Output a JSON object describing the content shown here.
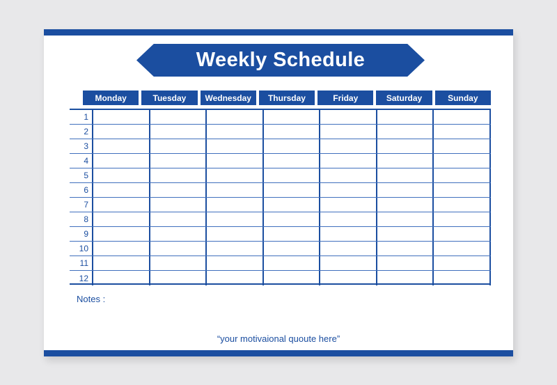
{
  "page": {
    "background_color": "#e8e8ea",
    "card_color": "#ffffff",
    "accent_color": "#1b4ea0",
    "line_color": "#3f6fbd"
  },
  "banner": {
    "title": "Weekly Schedule"
  },
  "table": {
    "day_headers": [
      "Monday",
      "Tuesday",
      "Wednesday",
      "Thursday",
      "Friday",
      "Saturday",
      "Sunday"
    ],
    "row_numbers": [
      "1",
      "2",
      "3",
      "4",
      "5",
      "6",
      "7",
      "8",
      "9",
      "10",
      "11",
      "12"
    ],
    "cells": [
      [
        "",
        "",
        "",
        "",
        "",
        "",
        ""
      ],
      [
        "",
        "",
        "",
        "",
        "",
        "",
        ""
      ],
      [
        "",
        "",
        "",
        "",
        "",
        "",
        ""
      ],
      [
        "",
        "",
        "",
        "",
        "",
        "",
        ""
      ],
      [
        "",
        "",
        "",
        "",
        "",
        "",
        ""
      ],
      [
        "",
        "",
        "",
        "",
        "",
        "",
        ""
      ],
      [
        "",
        "",
        "",
        "",
        "",
        "",
        ""
      ],
      [
        "",
        "",
        "",
        "",
        "",
        "",
        ""
      ],
      [
        "",
        "",
        "",
        "",
        "",
        "",
        ""
      ],
      [
        "",
        "",
        "",
        "",
        "",
        "",
        ""
      ],
      [
        "",
        "",
        "",
        "",
        "",
        "",
        ""
      ],
      [
        "",
        "",
        "",
        "",
        "",
        "",
        ""
      ]
    ]
  },
  "footer": {
    "notes_label": "Notes :",
    "quote": "“your motivaional quoute here”"
  }
}
